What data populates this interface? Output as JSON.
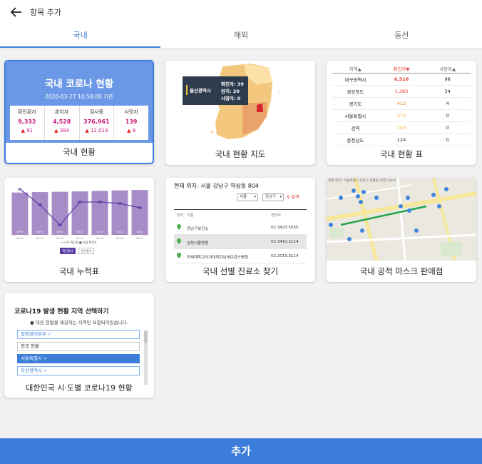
{
  "header": {
    "title": "항목 추가"
  },
  "tabs": [
    {
      "label": "국내"
    },
    {
      "label": "해외"
    },
    {
      "label": "동선"
    }
  ],
  "cards": {
    "status": {
      "title": "국내 코로나 현황",
      "date": "2020-03-27 10:58:00 기준",
      "stats": [
        {
          "label": "확진환자",
          "value": "9,332",
          "delta": "91"
        },
        {
          "label": "완치자",
          "value": "4,528",
          "delta": "384"
        },
        {
          "label": "검사중",
          "value": "376,961",
          "delta": "12,019"
        },
        {
          "label": "사망자",
          "value": "139",
          "delta": "8"
        }
      ],
      "label": "국내 현황"
    },
    "map": {
      "tooltip_city": "울산광역시",
      "tooltip_lines": [
        "확진자: 39",
        "완치: 20",
        "사망자: 0"
      ],
      "label": "국내 현황 지도"
    },
    "table": {
      "headers": [
        "지역▲",
        "확진자▼",
        "사망자▲"
      ],
      "rows": [
        {
          "region": "대구광역시",
          "confirmed": "6,516",
          "deaths": "98"
        },
        {
          "region": "경상북도",
          "confirmed": "1,283",
          "deaths": "34"
        },
        {
          "region": "경기도",
          "confirmed": "412",
          "deaths": "4"
        },
        {
          "region": "서울특별시",
          "confirmed": "372",
          "deaths": "0"
        },
        {
          "region": "검역",
          "confirmed": "144",
          "deaths": "0"
        },
        {
          "region": "충청남도",
          "confirmed": "124",
          "deaths": "0"
        }
      ],
      "label": "국내 현황 표"
    },
    "cumulative": {
      "bar_values": [
        "8799",
        "8897",
        "8961",
        "9037",
        "9137",
        "9241",
        "9332"
      ],
      "line_value": "147",
      "x_labels": [
        "03-21",
        "03-22",
        "03-23",
        "03-24",
        "03-25",
        "03-26",
        "03-27"
      ],
      "legend": "━ 누적 확진자  ■ 일일 확진자",
      "btn_confirmed": "확진환자",
      "btn_recovered": "완치환자",
      "label": "국내 누적표"
    },
    "clinic": {
      "location": "현재 위치: 서울 강남구 역삼동 804",
      "select1": "서울",
      "select2": "강남구",
      "search": "검색",
      "col_no": "번지",
      "col_name": "이름",
      "col_phone": "연락처",
      "rows": [
        {
          "name": "강남구보건소",
          "phone": "02.3423.5555"
        },
        {
          "name": "삼성서울병원",
          "phone": "02.3410.2114"
        },
        {
          "name": "연세대학교의과대학강남세브란스병원",
          "phone": "02.2019.3114"
        }
      ],
      "label": "국내 선별 진료소 찾기"
    },
    "mask": {
      "caption": "현재 위치 : 서울특별시 강남구 선릉동 (반경 1km)",
      "label": "국내 공적 마스크 판매점"
    },
    "regions": {
      "title": "코로나19 발생 현황 지역 선택하기",
      "desc": "● 대응 현황을 제공하는 지역만 표함되어있습니다.",
      "items": [
        "질병관리본부 ✓",
        "전국 현황",
        "서울특별시 ✓",
        "부산광역시 ✓"
      ],
      "label": "대한민국 시·도별 코로나19 현황"
    }
  },
  "add_button": "추가",
  "colors": {
    "accent": "#3b7dd8",
    "status_card": "#6a98e6",
    "chart_bar": "#a78cc8",
    "chart_line": "#5a3ea8"
  }
}
